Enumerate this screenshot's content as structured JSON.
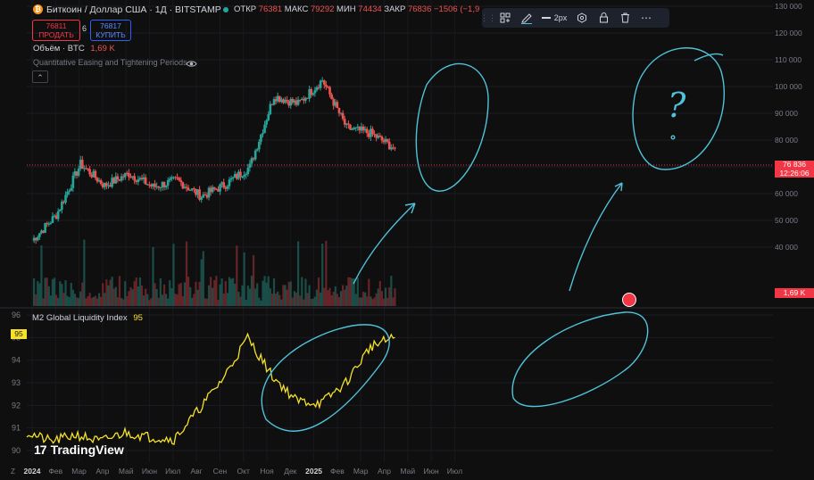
{
  "header": {
    "coin_glyph": "₿",
    "symbol_title": "Биткоин / Доллар США · 1Д · BITSTAMP",
    "open_label": "ОТКР",
    "open_value": "76381",
    "high_label": "МАКС",
    "high_value": "79292",
    "low_label": "МИН",
    "low_value": "74434",
    "close_label": "ЗАКР",
    "close_value": "76836",
    "change_value": "−1506 (−1,9",
    "sell_price": "76811",
    "sell_label": "ПРОДАТЬ",
    "spread": "6",
    "buy_price": "76817",
    "buy_label": "КУПИТЬ",
    "volume_label": "Объём · BTC",
    "volume_value": "1,69 K",
    "indicator_label": "Quantitative Easing and Tightening Periods",
    "collapse_glyph": "⌃"
  },
  "toolbar": {
    "grip": "⋮⋮",
    "width_label": "2px",
    "more": "⋯"
  },
  "price_axis": {
    "ticks": [
      "130 000",
      "120 000",
      "110 000",
      "100 000",
      "90 000",
      "80 000",
      "70 000",
      "60 000",
      "50 000",
      "40 000"
    ],
    "current_price": "76 836",
    "countdown": "12:26:06",
    "volume_badge": "1,69 K",
    "colors": {
      "up": "#26a69a",
      "down": "#ef5350",
      "price_line": "#f23645"
    }
  },
  "lower_pane": {
    "title": "M2 Global Liquidity Index",
    "value": "95",
    "axis_ticks": [
      "96",
      "95",
      "94",
      "93",
      "92",
      "91",
      "90"
    ],
    "line_color": "#f5e02a"
  },
  "time_axis": {
    "corner": "Z",
    "labels": [
      "2024",
      "Фев",
      "Мар",
      "Апр",
      "Май",
      "Июн",
      "Июл",
      "Авг",
      "Сен",
      "Окт",
      "Ноя",
      "Дек",
      "2025",
      "Фев",
      "Мар",
      "Апр",
      "Май",
      "Июн",
      "Июл"
    ]
  },
  "watermark": {
    "logo": "17",
    "text": "TradingView"
  },
  "annotation": {
    "question_mark": "?",
    "color": "#4fc3d9"
  },
  "chart_data": [
    {
      "type": "candlestick",
      "title": "Биткоин / Доллар США · 1Д · BITSTAMP",
      "x": [
        "2024-01",
        "2024-02",
        "2024-03",
        "2024-04",
        "2024-05",
        "2024-06",
        "2024-07",
        "2024-08",
        "2024-09",
        "2024-10",
        "2024-11",
        "2024-12",
        "2025-01",
        "2025-02",
        "2025-03",
        "2025-04"
      ],
      "series": [
        {
          "values": [
            42500,
            52000,
            71000,
            63000,
            67500,
            62500,
            65000,
            59000,
            63500,
            70000,
            96500,
            93500,
            102500,
            84500,
            82500,
            76836
          ]
        }
      ],
      "ylim": [
        35000,
        130000
      ],
      "y_unit": "USD",
      "current_price": 76836,
      "volume": {
        "series": [
          {
            "name": "Объём · BTC",
            "last": "1,69 K"
          }
        ]
      }
    },
    {
      "type": "line",
      "title": "M2 Global Liquidity Index",
      "x": [
        "2024-01",
        "2024-02",
        "2024-03",
        "2024-04",
        "2024-05",
        "2024-06",
        "2024-07",
        "2024-08",
        "2024-09",
        "2024-10",
        "2024-11",
        "2024-12",
        "2025-01",
        "2025-02",
        "2025-03",
        "2025-04"
      ],
      "series": [
        {
          "name": "M2 Global Liquidity Index",
          "values": [
            90.8,
            90.4,
            90.7,
            90.4,
            90.8,
            90.6,
            90.5,
            91.8,
            93.2,
            95.0,
            93.3,
            92.2,
            92.1,
            93.0,
            94.6,
            95.0
          ]
        }
      ],
      "ylim": [
        89.7,
        96.2
      ]
    }
  ]
}
